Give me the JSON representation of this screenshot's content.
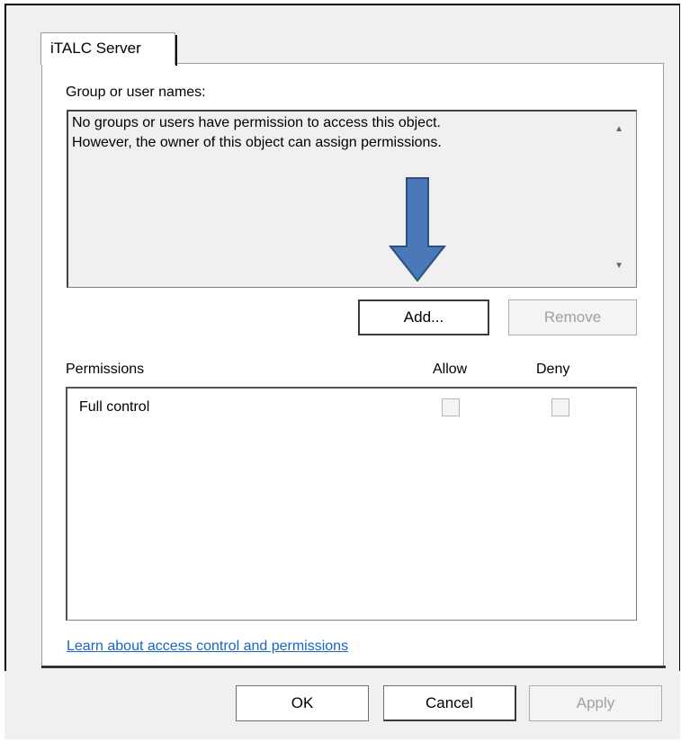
{
  "tab": {
    "label": "iTALC Server"
  },
  "group_section": {
    "label": "Group or user names:",
    "message_line1": "No groups or users have permission to access this object.",
    "message_line2": "However, the owner of this object can assign permissions.",
    "add_label": "Add...",
    "remove_label": "Remove"
  },
  "permissions": {
    "label": "Permissions",
    "allow_header": "Allow",
    "deny_header": "Deny",
    "rows": [
      {
        "name": "Full control",
        "allow": false,
        "deny": false
      }
    ]
  },
  "link": {
    "text": "Learn about access control and permissions"
  },
  "footer": {
    "ok_label": "OK",
    "cancel_label": "Cancel",
    "apply_label": "Apply"
  },
  "annotation": {
    "arrow_color": "#4a78b8",
    "arrow_icon": "arrow-down-icon"
  }
}
